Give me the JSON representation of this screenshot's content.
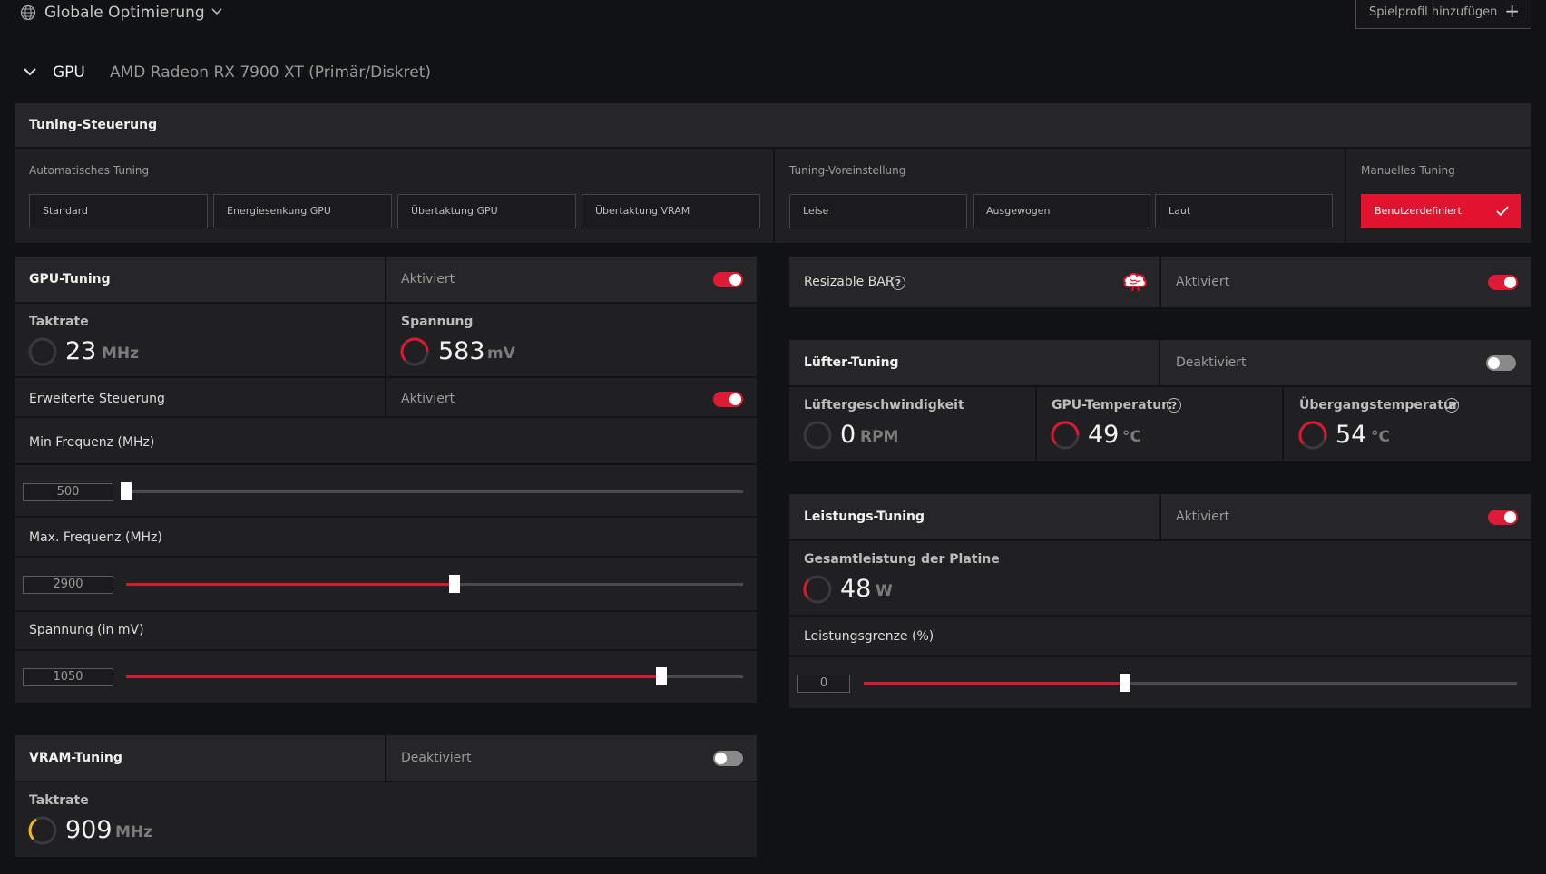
{
  "topbar": {
    "profile_title": "Globale Optimierung",
    "add_profile_label": "Spielprofil hinzufügen",
    "add_icon": "+"
  },
  "gpu_header": {
    "label": "GPU",
    "device": "AMD Radeon RX 7900 XT (Primär/Diskret)"
  },
  "tuning_control": {
    "title": "Tuning-Steuerung",
    "auto": {
      "label": "Automatisches Tuning",
      "buttons": [
        "Standard",
        "Energiesenkung GPU",
        "Übertaktung GPU",
        "Übertaktung VRAM"
      ]
    },
    "preset": {
      "label": "Tuning-Voreinstellung",
      "buttons": [
        "Leise",
        "Ausgewogen",
        "Laut"
      ]
    },
    "manual": {
      "label": "Manuelles Tuning",
      "button": "Benutzerdefiniert",
      "selected": true
    }
  },
  "gpu_tuning": {
    "title": "GPU-Tuning",
    "status": "Aktiviert",
    "enabled": true,
    "clock": {
      "label": "Taktrate",
      "value": "23",
      "unit": "MHz",
      "level": 0.0
    },
    "voltage": {
      "label": "Spannung",
      "value": "583",
      "unit": "mV",
      "level": 0.55
    },
    "advanced": {
      "label": "Erweiterte Steuerung",
      "status": "Aktiviert",
      "enabled": true
    },
    "min_freq": {
      "label": "Min Frequenz (MHz)",
      "value": "500",
      "fraction": 0.0
    },
    "max_freq": {
      "label": "Max. Frequenz (MHz)",
      "value": "2900",
      "fraction": 0.533
    },
    "voltage_slider": {
      "label": "Spannung (in mV)",
      "value": "1050",
      "fraction": 0.867
    }
  },
  "vram_tuning": {
    "title": "VRAM-Tuning",
    "status": "Deaktiviert",
    "enabled": false,
    "clock": {
      "label": "Taktrate",
      "value": "909",
      "unit": "MHz",
      "level": 0.4
    }
  },
  "resizable_bar": {
    "label": "Resizable BAR",
    "help": "?",
    "status": "Aktiviert",
    "enabled": true
  },
  "fan_tuning": {
    "title": "Lüfter-Tuning",
    "status": "Deaktiviert",
    "enabled": false,
    "fan_speed": {
      "label": "Lüftergeschwindigkeit",
      "value": "0",
      "unit": "RPM",
      "level": 0.0
    },
    "gpu_temp": {
      "label": "GPU-Temperatur:",
      "help": "?",
      "value": "49",
      "unit": "°C",
      "level": 0.55
    },
    "junction_temp": {
      "label": "Übergangstemperatur",
      "help": "?",
      "value": "54",
      "unit": "°C",
      "level": 0.6
    }
  },
  "power_tuning": {
    "title": "Leistungs-Tuning",
    "status": "Aktiviert",
    "enabled": true,
    "board_power": {
      "label": "Gesamtleistung der Platine",
      "value": "48",
      "unit": "W",
      "level": 0.25
    },
    "power_limit": {
      "label": "Leistungsgrenze (%)",
      "value": "0",
      "fraction": 0.4
    }
  },
  "colors": {
    "accent": "#df1a35",
    "gauge_red": "#d71932",
    "gauge_yellow": "#f0b81e",
    "background": "#111214",
    "panel": "#202022"
  },
  "icons": {
    "globe": "globe-icon",
    "chevron": "chevron-down-icon",
    "check": "check-icon",
    "brain": "brain-icon"
  }
}
